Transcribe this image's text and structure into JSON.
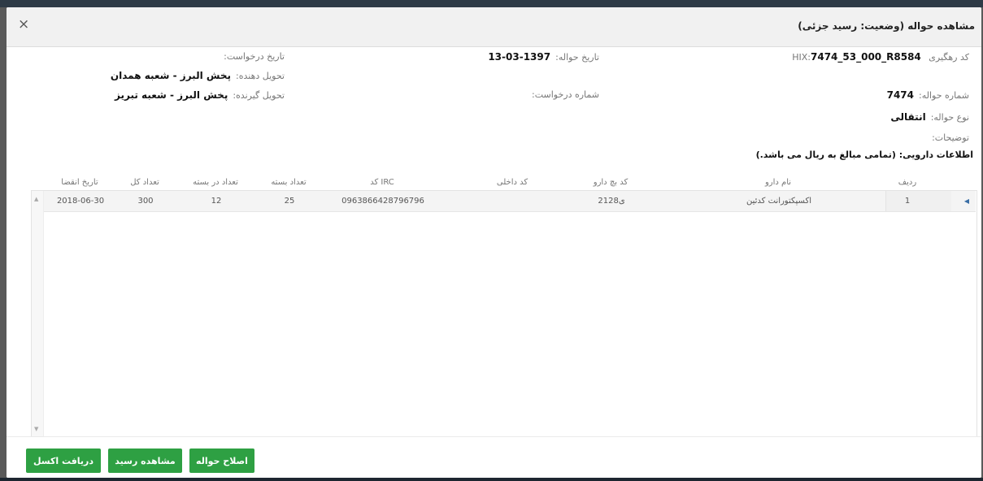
{
  "modal": {
    "title": "مشاهده حواله (وضعیت: رسید جزئی)",
    "close": "×"
  },
  "fields": {
    "tracking_label": "کد رهگیری HIX:",
    "tracking_value": "7474_53_000_R8584",
    "hawala_date_label": "تاریخ حواله:",
    "hawala_date_value": "1397-03-13",
    "request_date_label": "تاریخ درخواست:",
    "giver_label": "تحویل دهنده:",
    "giver_value": "پخش البرز - شعبه همدان",
    "hawala_no_label": "شماره حواله:",
    "hawala_no_value": "7474",
    "request_no_label": "شماره درخواست:",
    "receiver_label": "تحویل گیرنده:",
    "receiver_value": "پخش البرز - شعبه تبریز",
    "type_label": "نوع حواله:",
    "type_value": "انتقالی",
    "desc_label": "توضیحات:",
    "drug_info": "اطلاعات دارویی: (تمامی مبالغ به ریال می باشد.)"
  },
  "table": {
    "headers": {
      "row": "ردیف",
      "drug_name": "نام دارو",
      "batch_code": "کد بچ دارو",
      "internal_code": "کد داخلی",
      "irc": "کد IRC",
      "packs": "تعداد بسته",
      "per_pack": "تعداد در بسته",
      "total": "تعداد کل",
      "expiry": "تاریخ انقضا"
    },
    "rows": [
      {
        "row": "1",
        "drug_name": "اکسپکتورانت کدئین",
        "batch_code": "2128ی",
        "internal_code": "",
        "irc": "0963866428796796",
        "packs": "25",
        "per_pack": "12",
        "total": "300",
        "expiry": "2018-06-30"
      }
    ]
  },
  "buttons": {
    "excel": "دریافت اکسل",
    "view_receipt": "مشاهده رسید",
    "edit_hawala": "اصلاح حواله"
  },
  "colors": {
    "button": "#2ea043",
    "header_bg": "#f1f1f1"
  }
}
